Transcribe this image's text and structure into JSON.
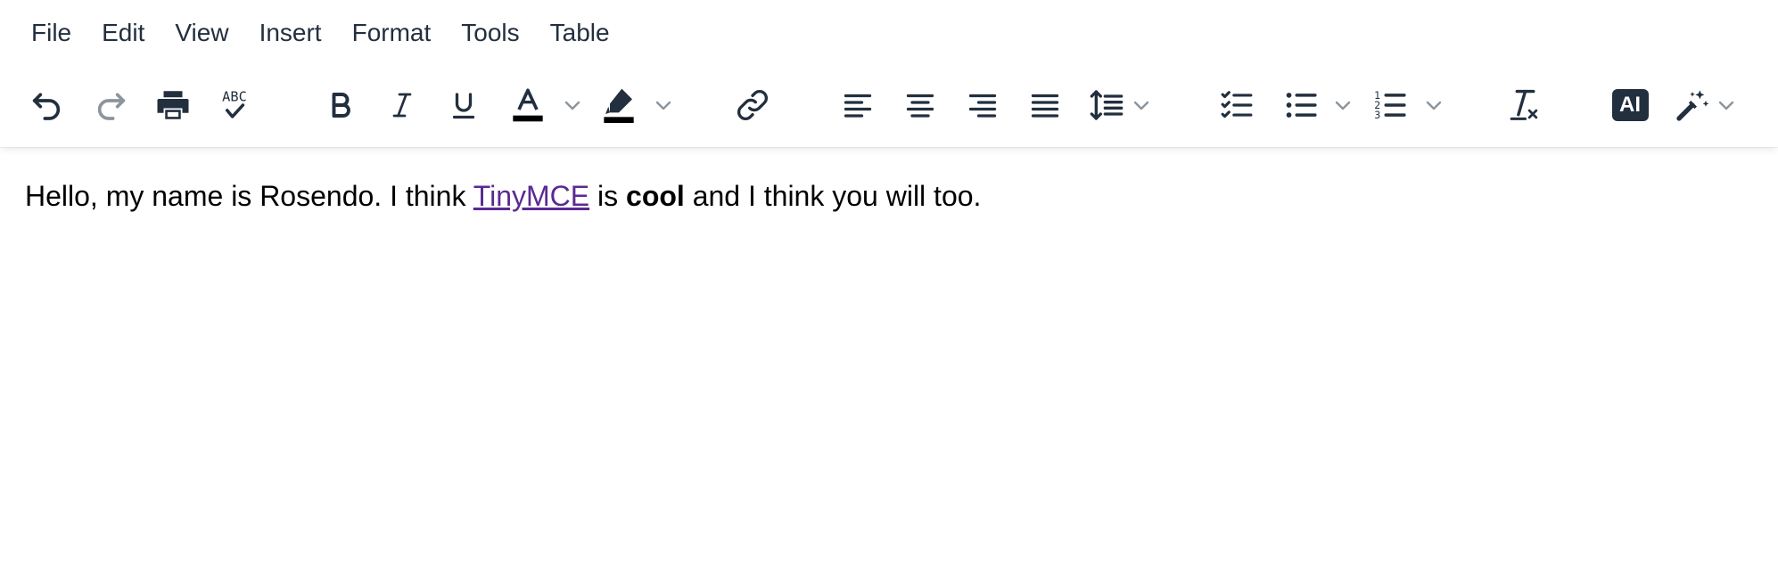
{
  "menubar": {
    "items": [
      "File",
      "Edit",
      "View",
      "Insert",
      "Format",
      "Tools",
      "Table"
    ]
  },
  "toolbar": {
    "buttons": [
      "undo-icon",
      "redo-icon",
      "print-icon",
      "spellcheck-icon",
      "bold-icon",
      "italic-icon",
      "underline-icon",
      "text-color-icon",
      "highlight-icon",
      "link-icon",
      "align-left-icon",
      "align-center-icon",
      "align-right-icon",
      "align-justify-icon",
      "line-height-icon",
      "checklist-icon",
      "bullet-list-icon",
      "numbered-list-icon",
      "remove-format-icon",
      "ai-assistant-icon",
      "magic-wand-icon"
    ],
    "ai_label": "AI",
    "spellcheck_label": "ABC",
    "colors": {
      "icon": "#222f3e",
      "disabled": "#8c949d",
      "link": "#5a2a93"
    }
  },
  "editor": {
    "before_link": "Hello, my name is Rosendo. I think ",
    "link_text": "TinyMCE",
    "middle": " is ",
    "bold_text": "cool",
    "after": " and I think you will too."
  }
}
